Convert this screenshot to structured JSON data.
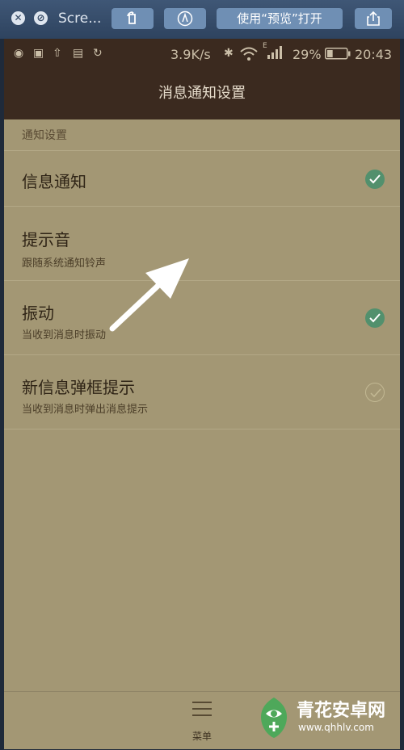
{
  "window": {
    "title": "Scre...",
    "open_with_preview": "使用“预览”打开"
  },
  "status_bar": {
    "speed": "3.9K/s",
    "signal_letter": "E",
    "battery": "29%",
    "time": "20:43"
  },
  "screen_title": "消息通知设置",
  "section_header": "通知设置",
  "settings": [
    {
      "title": "信息通知",
      "subtitle": "",
      "checked": true
    },
    {
      "title": "提示音",
      "subtitle": "跟随系统通知铃声",
      "checked": null
    },
    {
      "title": "振动",
      "subtitle": "当收到消息时振动",
      "checked": true
    },
    {
      "title": "新信息弹框提示",
      "subtitle": "当收到消息时弹出消息提示",
      "checked": false
    }
  ],
  "bottom_nav": {
    "menu_label": "菜单"
  },
  "watermark": {
    "name": "青花安卓网",
    "url": "www.qhhlv.com"
  },
  "colors": {
    "checked": "#52906d",
    "header": "#3b2a1f",
    "background": "#a39774"
  }
}
